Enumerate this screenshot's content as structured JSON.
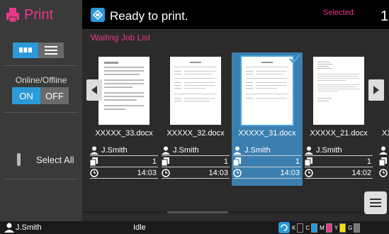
{
  "app": {
    "title": "Print"
  },
  "sidebar": {
    "online_label": "Online/Offline",
    "on_label": "ON",
    "off_label": "OFF",
    "select_all_label": "Select All"
  },
  "header": {
    "status_text": "Ready to print.",
    "selected_label": "Selected:",
    "selected_count": "1"
  },
  "list_title": "Waiting Job List",
  "jobs": [
    {
      "name": "XXXXX_33.docx",
      "user": "J.Smith",
      "copies": "1",
      "time": "14:03",
      "selected": false
    },
    {
      "name": "XXXXX_32.docx",
      "user": "J.Smith",
      "copies": "1",
      "time": "14:03",
      "selected": false
    },
    {
      "name": "XXXXX_31.docx",
      "user": "J.Smith",
      "copies": "1",
      "time": "14:03",
      "selected": true
    },
    {
      "name": "XXXXX_21.docx",
      "user": "J.Smith",
      "copies": "1",
      "time": "14:02",
      "selected": false
    },
    {
      "name": "XX",
      "user": "",
      "copies": "",
      "time": "",
      "selected": false
    }
  ],
  "statusbar": {
    "user": "J.Smith",
    "status": "Idle",
    "inks": [
      {
        "label": "K",
        "color": "#333333",
        "level": 0
      },
      {
        "label": "C",
        "color": "#1e9be0",
        "level": 1
      },
      {
        "label": "M",
        "color": "#e8388a",
        "level": 1
      },
      {
        "label": "Y",
        "color": "#f2e200",
        "level": 1
      },
      {
        "label": "G",
        "color": "#777777",
        "level": 1
      }
    ]
  },
  "colors": {
    "accent": "#2a9ad8",
    "brand": "#e8388a"
  }
}
